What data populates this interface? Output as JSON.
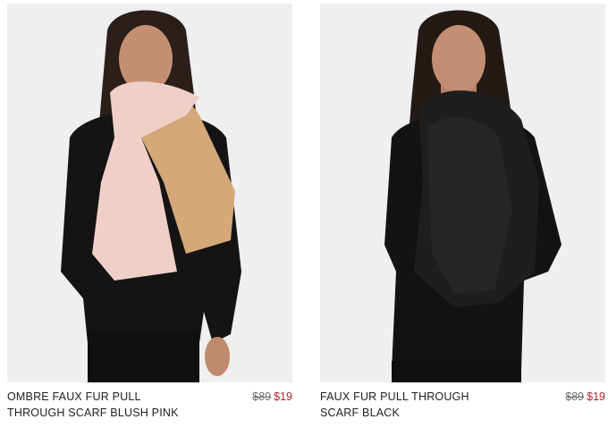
{
  "products": [
    {
      "name": "OMBRE FAUX FUR PULL THROUGH SCARF BLUSH PINK",
      "original_price": "$89",
      "sale_price": "$19",
      "scarf_colors": [
        "#f0cfc9",
        "#d4a879"
      ]
    },
    {
      "name": "FAUX FUR PULL THROUGH SCARF BLACK",
      "original_price": "$89",
      "sale_price": "$19",
      "scarf_colors": [
        "#141414",
        "#222222"
      ]
    }
  ],
  "colors": {
    "sale_price": "#b0262e",
    "original_price": "#6b6b6b",
    "image_background": "#efefef"
  }
}
